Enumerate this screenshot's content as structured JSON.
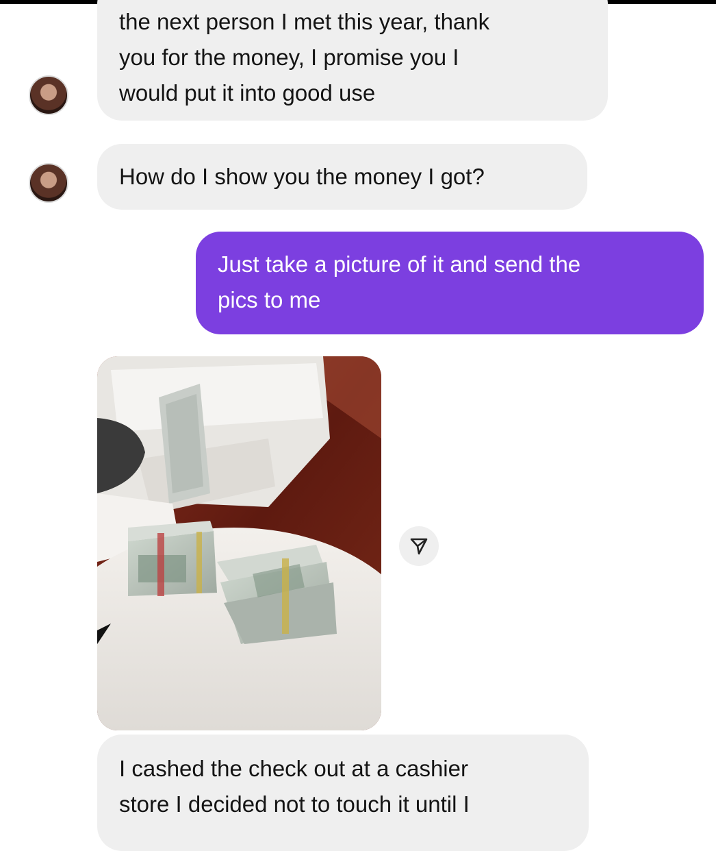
{
  "chat": {
    "messages": [
      {
        "from": "other",
        "text": "the next person I met this year, thank\nyou for the money, I promise you I\nwould put it into good use"
      },
      {
        "from": "other",
        "text": "How do I show you the money I got?"
      },
      {
        "from": "me",
        "text": "Just take a picture of it and send the\npics to me"
      },
      {
        "from": "other",
        "type": "photo",
        "alt": "stacks of banded dollar bills on a round white table"
      },
      {
        "from": "other",
        "text": "I cashed the check out at a cashier\nstore I decided not to touch it until I"
      }
    ]
  },
  "icons": {
    "avatar": "avatar",
    "share": "share-arrow-icon"
  },
  "colors": {
    "outgoing_bubble": "#7c3fe0",
    "incoming_bubble": "#efefef"
  }
}
